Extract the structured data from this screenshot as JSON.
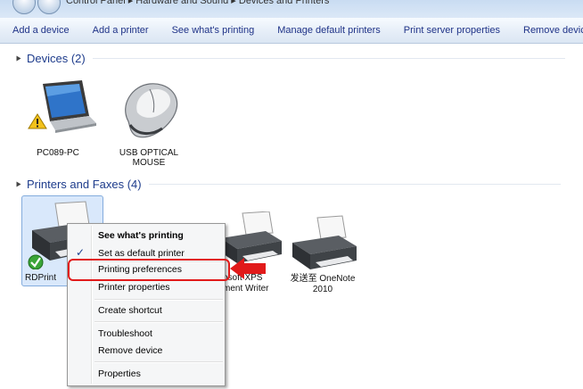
{
  "address": {
    "crumb": "Control Panel  ▸  Hardware and Sound  ▸  Devices and Printers"
  },
  "toolbar": {
    "items": [
      "Add a device",
      "Add a printer",
      "See what's printing",
      "Manage default printers",
      "Print server properties",
      "Remove device"
    ]
  },
  "groups": {
    "devices": "Devices (2)",
    "printers": "Printers and Faxes (4)"
  },
  "devices": [
    {
      "name": "PC089-PC",
      "icon": "laptop-warning-icon"
    },
    {
      "name_line1": "USB OPTICAL",
      "name_line2": "MOUSE",
      "icon": "mouse-icon"
    }
  ],
  "printers": [
    {
      "name": "RDPrint",
      "icon": "printer-default-icon"
    },
    {
      "name_partial1": "osoft XPS",
      "name_partial2": "ment Writer",
      "icon": "printer-icon"
    },
    {
      "name_line1": "发送至 OneNote",
      "name_line2": "2010",
      "icon": "printer-icon"
    }
  ],
  "context_menu": {
    "items": [
      {
        "label": "See what's printing",
        "bold": true
      },
      {
        "label": "Set as default printer",
        "check": "✓"
      },
      {
        "label": "Printing preferences"
      },
      {
        "label": "Printer properties"
      },
      {
        "label": "Create shortcut"
      },
      {
        "label": "Troubleshoot"
      },
      {
        "label": "Remove device"
      },
      {
        "label": "Properties"
      }
    ]
  },
  "colors": {
    "link": "#1e3287",
    "group_header": "#1e3c8c",
    "highlight": "#e11a1a",
    "selection": "#d9e8fb"
  }
}
